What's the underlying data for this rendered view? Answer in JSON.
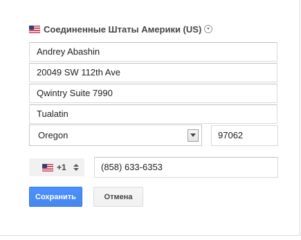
{
  "country": {
    "label": "Соединенные Штаты Америки (US)",
    "flag_icon": "us-flag-icon"
  },
  "address": {
    "name": "Andrey Abashin",
    "line1": "20049 SW 112th Ave",
    "line2": "Qwintry Suite 7990",
    "city": "Tualatin",
    "state": "Oregon",
    "zip": "97062"
  },
  "phone": {
    "country_code": "+1",
    "number": "(858) 633-6353"
  },
  "buttons": {
    "save": "Сохранить",
    "cancel": "Отмена"
  },
  "colors": {
    "primary": "#4d90fe",
    "secondary_bg": "#f5f5f5"
  }
}
